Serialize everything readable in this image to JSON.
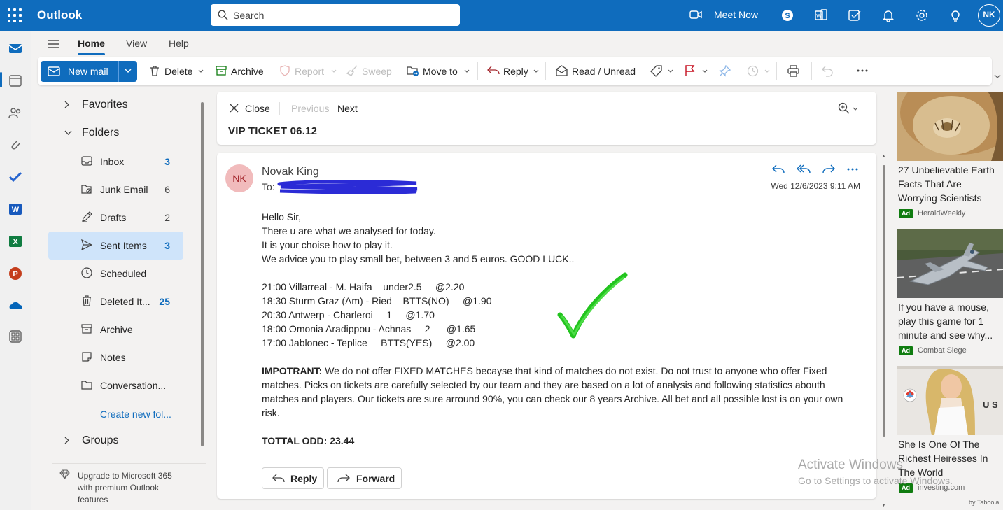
{
  "topbar": {
    "app_name": "Outlook",
    "search_placeholder": "Search",
    "meet_now": "Meet Now",
    "avatar": "NK",
    "background": "#0f6cbd"
  },
  "ribbon": {
    "tabs": [
      "Home",
      "View",
      "Help"
    ],
    "new_mail": "New mail",
    "delete": "Delete",
    "archive": "Archive",
    "report": "Report",
    "sweep": "Sweep",
    "move_to": "Move to",
    "reply": "Reply",
    "read_unread": "Read / Unread"
  },
  "folders": {
    "favorites": "Favorites",
    "folders_heading": "Folders",
    "items": [
      {
        "label": "Inbox",
        "count": "3",
        "icon": "inbox-icon"
      },
      {
        "label": "Junk Email",
        "count": "6",
        "icon": "junk-icon"
      },
      {
        "label": "Drafts",
        "count": "2",
        "icon": "drafts-icon"
      },
      {
        "label": "Sent Items",
        "count": "3",
        "icon": "sent-icon"
      },
      {
        "label": "Scheduled",
        "count": "",
        "icon": "clock-icon"
      },
      {
        "label": "Deleted It...",
        "count": "25",
        "icon": "trash-icon"
      },
      {
        "label": "Archive",
        "count": "",
        "icon": "archive-icon"
      },
      {
        "label": "Notes",
        "count": "",
        "icon": "note-icon"
      },
      {
        "label": "Conversation...",
        "count": "",
        "icon": "folder-icon"
      }
    ],
    "create_new": "Create new fol...",
    "groups": "Groups",
    "upgrade": "Upgrade to Microsoft 365 with premium Outlook features"
  },
  "reading": {
    "close": "Close",
    "previous": "Previous",
    "next": "Next",
    "subject": "VIP TICKET 06.12"
  },
  "message": {
    "avatar": "NK",
    "sender": "Novak King",
    "to_label": "To:",
    "date": "Wed 12/6/2023 9:11 AM",
    "greeting": [
      "Hello Sir,",
      "There u are what we analysed for today.",
      "It is your choise how to play it.",
      "We advice you to play small bet, between 3 and 5 euros. GOOD LUCK.."
    ],
    "matches": [
      "21:00 Villarreal - M. Haifa    under2.5     @2.20",
      "18:30 Sturm Graz (Am) - Ried    BTTS(NO)     @1.90",
      "20:30 Antwerp - Charleroi     1     @1.70",
      "18:00 Omonia Aradippou - Achnas     2      @1.65",
      "17:00 Jablonec - Teplice     BTTS(YES)     @2.00"
    ],
    "important_label": "IMPOTRANT:",
    "important_text": " We do not offer FIXED MATCHES becayse that kind of matches do not exist. Do not trust to anyone who offer Fixed matches. Picks on tickets are carefully selected by our team and they are based on a lot of analysis and following statistics abouth matches and players. Our tickets are sure arround 90%, you can check our 8 years Archive. All bet and all possible lost is on your own risk.",
    "total": "TOTTAL ODD: 23.44",
    "reply_button": "Reply",
    "forward_button": "Forward",
    "check_color": "#22c41e"
  },
  "watermark": {
    "title": "Activate Windows",
    "subtitle": "Go to Settings to activate Windows."
  },
  "ads": [
    {
      "title": "27 Unbelievable Earth Facts That Are Worrying Scientists",
      "badge": "Ad",
      "source": "HeraldWeekly"
    },
    {
      "title": "If you have a mouse, play this game for 1 minute and see why...",
      "badge": "Ad",
      "source": "Combat Siege"
    },
    {
      "title": "She Is One Of The Richest Heiresses In The World",
      "badge": "Ad",
      "source": "investing.com"
    }
  ],
  "taboola": "by Taboola"
}
